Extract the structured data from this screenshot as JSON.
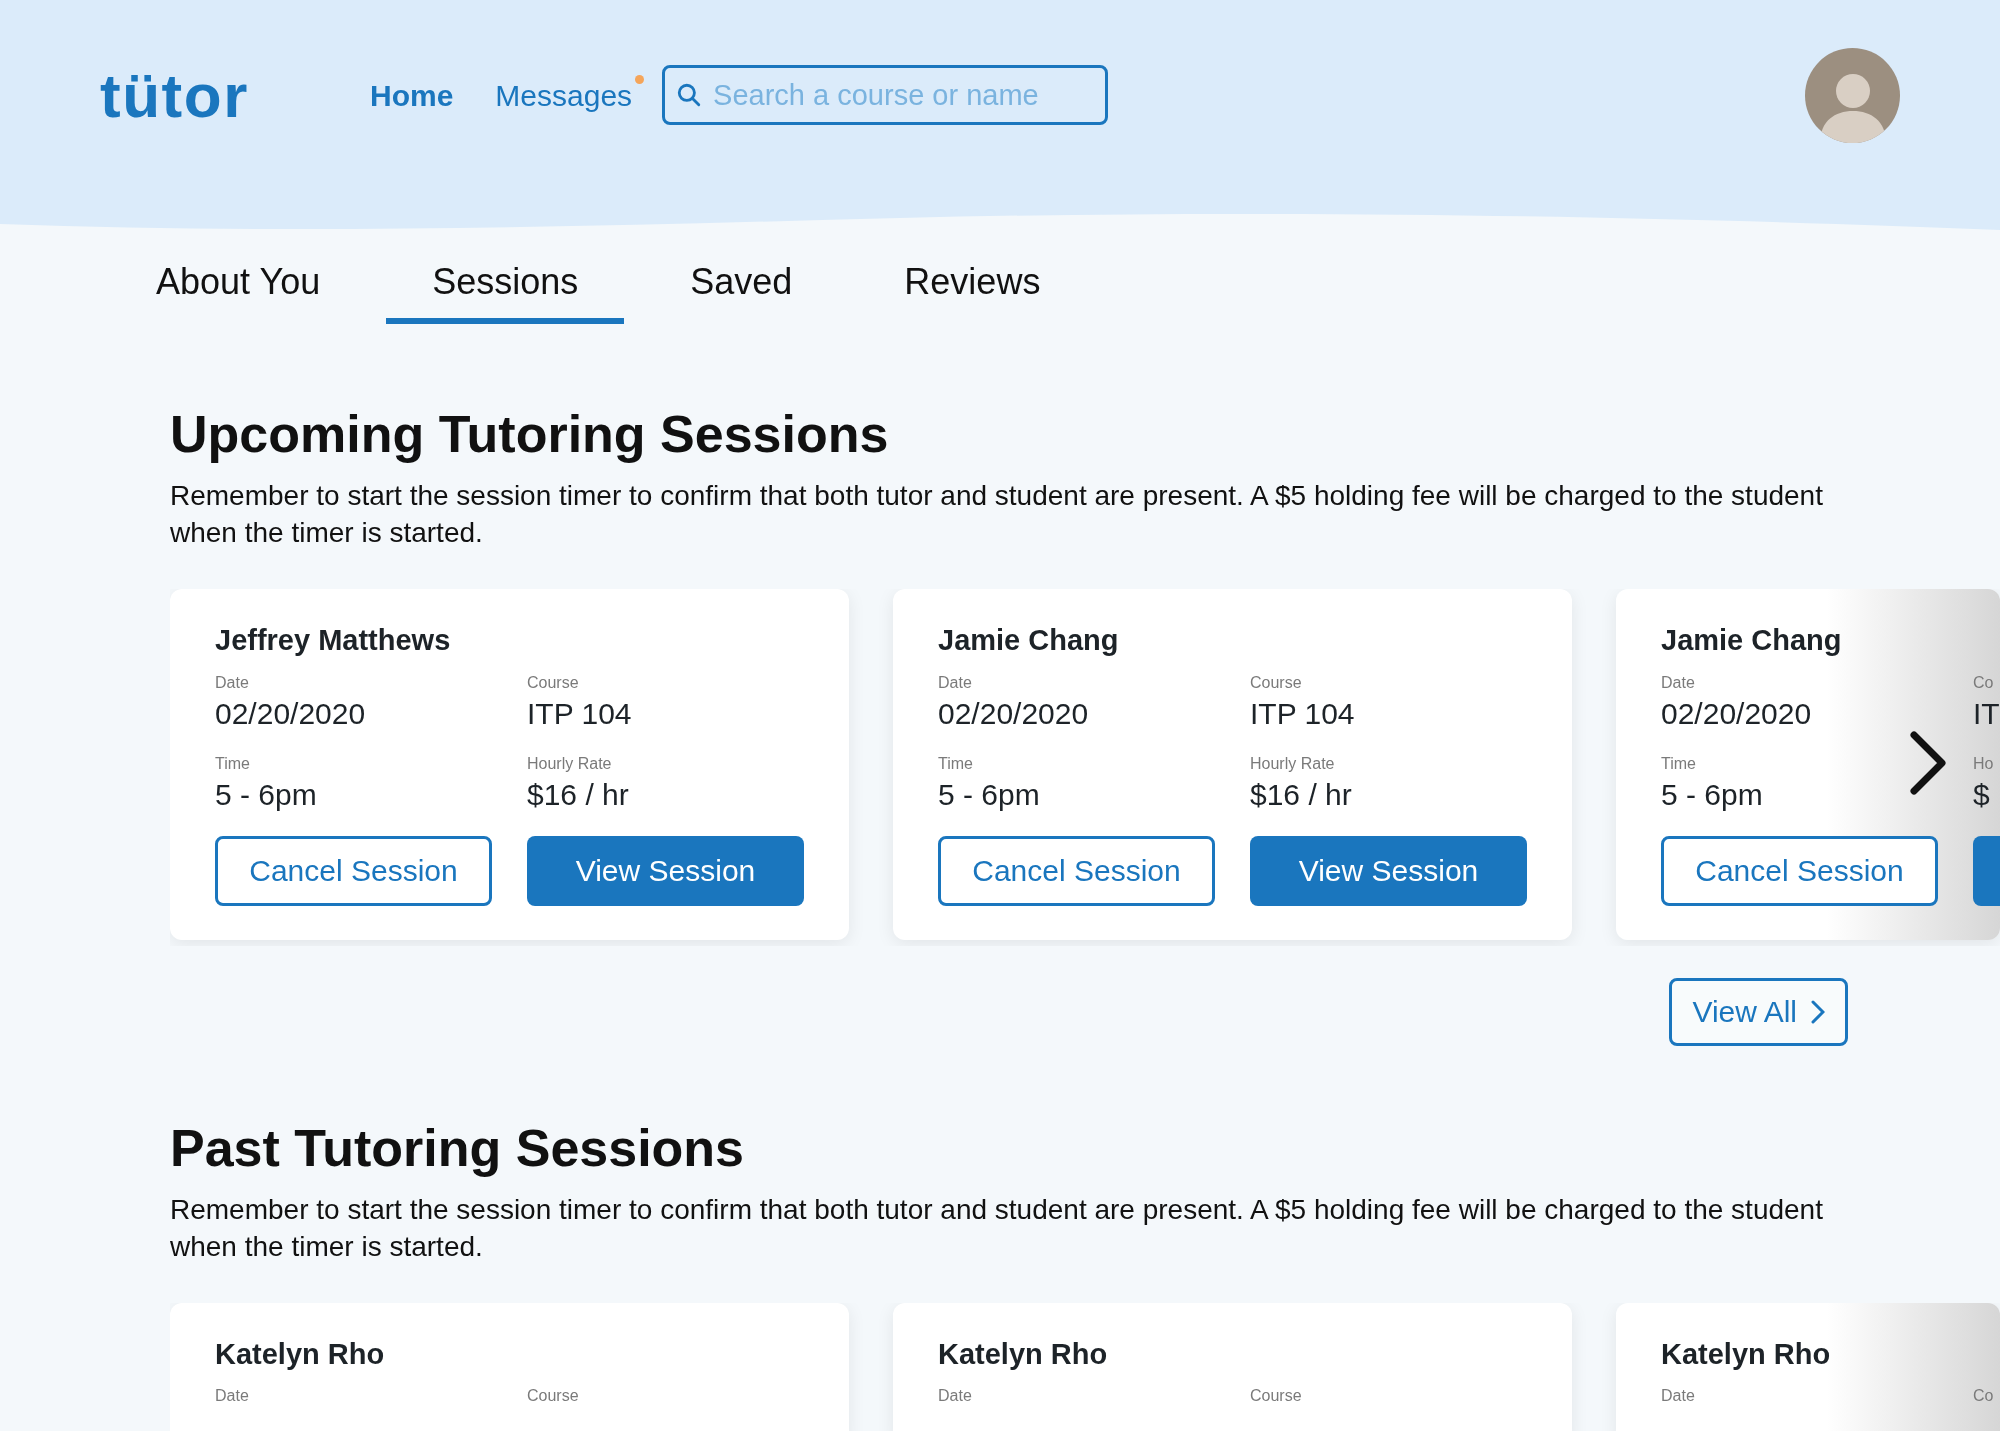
{
  "header": {
    "logo": "tütor",
    "nav": [
      {
        "label": "Home",
        "selected": true,
        "badge": false
      },
      {
        "label": "Messages",
        "selected": false,
        "badge": true
      }
    ],
    "search": {
      "placeholder": "Search a course or name"
    }
  },
  "tabs": [
    {
      "label": "About You",
      "selected": false
    },
    {
      "label": "Sessions",
      "selected": true
    },
    {
      "label": "Saved",
      "selected": false
    },
    {
      "label": "Reviews",
      "selected": false
    }
  ],
  "upcoming": {
    "title": "Upcoming Tutoring Sessions",
    "note": "Remember to start the session timer to confirm that both tutor and student are present. A $5 holding fee will be charged to the student when the timer is started.",
    "cards": [
      {
        "name": "Jeffrey Matthews",
        "date_label": "Date",
        "date": "02/20/2020",
        "course_label": "Course",
        "course": "ITP 104",
        "time_label": "Time",
        "time": "5 - 6pm",
        "rate_label": "Hourly Rate",
        "rate": "$16 / hr",
        "cancel": "Cancel Session",
        "view": "View Session",
        "faded": false
      },
      {
        "name": "Jamie Chang",
        "date_label": "Date",
        "date": "02/20/2020",
        "course_label": "Course",
        "course": "ITP 104",
        "time_label": "Time",
        "time": "5 - 6pm",
        "rate_label": "Hourly Rate",
        "rate": "$16 / hr",
        "cancel": "Cancel Session",
        "view": "View Session",
        "faded": false
      },
      {
        "name": "Jamie Chang",
        "date_label": "Date",
        "date": "02/20/2020",
        "course_label": "Co",
        "course": "IT",
        "time_label": "Time",
        "time": "5 - 6pm",
        "rate_label": "Ho",
        "rate": "$",
        "cancel": "Cancel Session",
        "faded": true
      }
    ],
    "view_all": "View All"
  },
  "past": {
    "title": "Past Tutoring Sessions",
    "note": "Remember to start the session timer to confirm that both tutor and student are present. A $5 holding fee will be charged to the student when the timer is started.",
    "cards": [
      {
        "name": "Katelyn Rho",
        "date_label": "Date",
        "course_label": "Course",
        "faded": false
      },
      {
        "name": "Katelyn Rho",
        "date_label": "Date",
        "course_label": "Course",
        "faded": false
      },
      {
        "name": "Katelyn Rho",
        "date_label": "Date",
        "course_label": "Co",
        "faded": true
      }
    ]
  }
}
